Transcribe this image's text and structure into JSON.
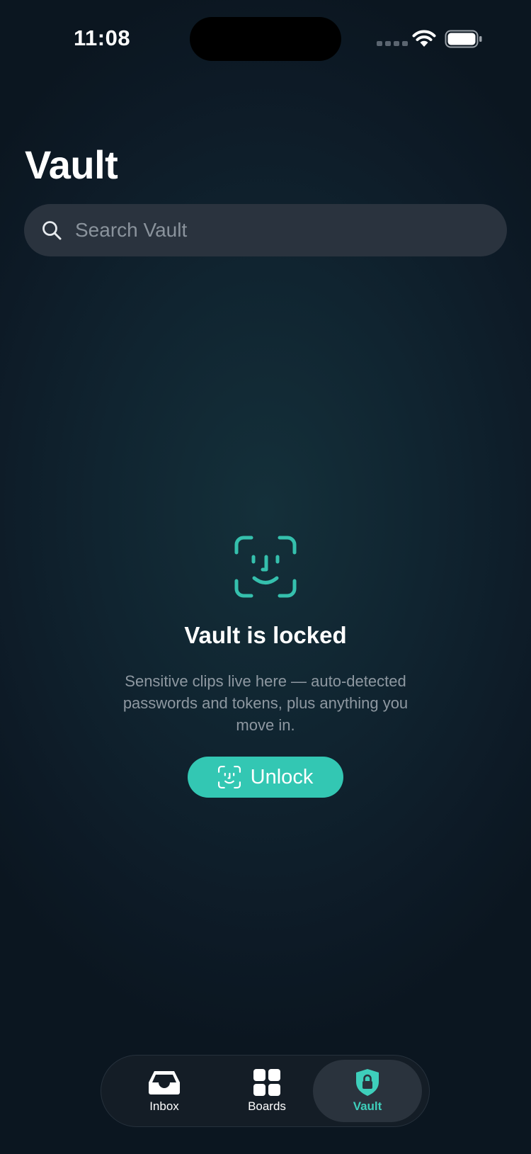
{
  "status_bar": {
    "time": "11:08"
  },
  "header": {
    "title": "Vault"
  },
  "search": {
    "placeholder": "Search Vault",
    "value": ""
  },
  "locked_state": {
    "title": "Vault is locked",
    "description": "Sensitive clips live here — auto-detected passwords and tokens, plus anything you move in.",
    "unlock_label": "Unlock",
    "icon": "face-id-icon"
  },
  "tab_bar": {
    "tabs": [
      {
        "label": "Inbox",
        "icon": "inbox-tray-icon",
        "active": false
      },
      {
        "label": "Boards",
        "icon": "grid-icon",
        "active": false
      },
      {
        "label": "Vault",
        "icon": "shield-lock-icon",
        "active": true
      }
    ]
  },
  "colors": {
    "accent": "#33c7b3",
    "background": "#0f1f2a",
    "search_field": "#2a333e",
    "secondary_text": "#8e98a1"
  }
}
